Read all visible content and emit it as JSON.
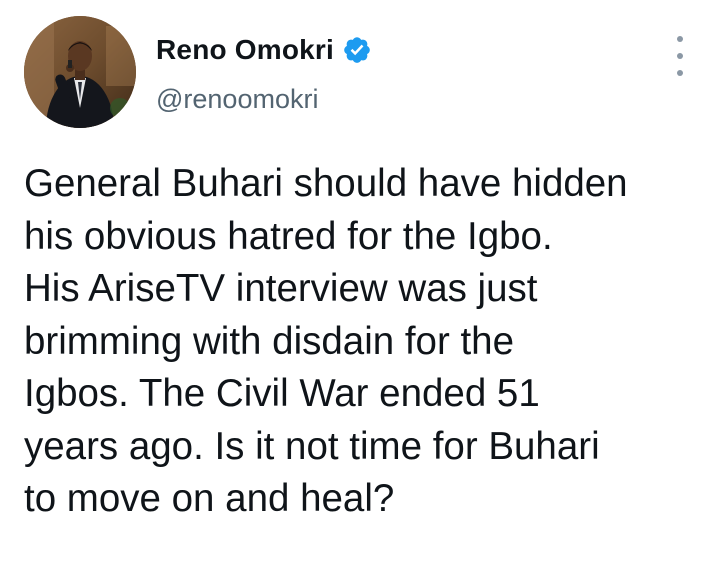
{
  "author": {
    "display_name": "Reno Omokri",
    "handle": "@renoomokri",
    "verified": true,
    "avatar_icon": "profile-photo-man-in-suit-with-microphone"
  },
  "tweet": {
    "text": "General Buhari should have hidden\nhis obvious hatred for the Igbo.\nHis AriseTV interview was just\nbrimming with disdain for the\nIgbos. The Civil War ended 51\nyears ago. Is it not time for Buhari\nto move on and heal?"
  },
  "menu": {
    "icon": "more-vertical-icon"
  },
  "colors": {
    "verified_badge": "#1d9bf0",
    "handle_text": "#536471",
    "body_text": "#0f1419"
  }
}
